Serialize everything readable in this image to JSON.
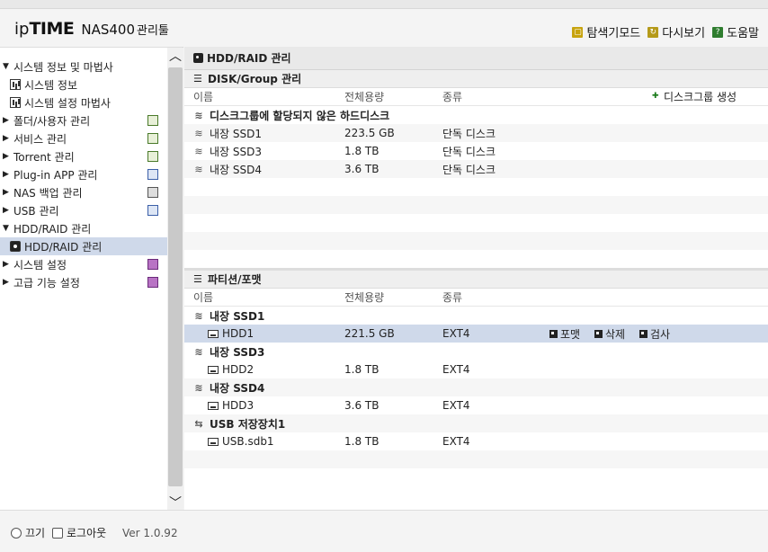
{
  "header": {
    "logo_ip": "ip",
    "logo_time": "TIME",
    "logo_model": "NAS400",
    "logo_sub": "관리툴",
    "links": [
      {
        "label": "탐색기모드",
        "icon": "explorer-icon"
      },
      {
        "label": "다시보기",
        "icon": "refresh-icon"
      },
      {
        "label": "도움말",
        "icon": "help-icon"
      }
    ]
  },
  "sidebar": {
    "items": [
      {
        "label": "시스템 정보 및 마법사",
        "expanded": true
      },
      {
        "label": "시스템 정보",
        "sub": true
      },
      {
        "label": "시스템 설정 마법사",
        "sub": true
      },
      {
        "label": "폴더/사용자 관리"
      },
      {
        "label": "서비스 관리"
      },
      {
        "label": "Torrent 관리"
      },
      {
        "label": "Plug-in APP 관리"
      },
      {
        "label": "NAS 백업 관리"
      },
      {
        "label": "USB 관리"
      },
      {
        "label": "HDD/RAID 관리",
        "expanded": true
      },
      {
        "label": "HDD/RAID 관리",
        "sub": true,
        "active": true
      },
      {
        "label": "시스템 설정"
      },
      {
        "label": "고급 기능 설정"
      }
    ]
  },
  "footer": {
    "power_label": "끄기",
    "logout_label": "로그아웃",
    "version": "Ver 1.0.92"
  },
  "main": {
    "title": "HDD/RAID 관리",
    "disk_section": {
      "title": "DISK/Group 관리",
      "col_name": "이름",
      "col_capacity": "전체용량",
      "col_type": "종류",
      "create_label": "디스크그룹 생성",
      "group_title": "디스크그룹에 할당되지 않은 하드디스크",
      "rows": [
        {
          "name": "내장 SSD1",
          "capacity": "223.5 GB",
          "type": "단독 디스크"
        },
        {
          "name": "내장 SSD3",
          "capacity": "1.8 TB",
          "type": "단독 디스크"
        },
        {
          "name": "내장 SSD4",
          "capacity": "3.6 TB",
          "type": "단독 디스크"
        }
      ]
    },
    "partition_section": {
      "title": "파티션/포맷",
      "col_name": "이름",
      "col_capacity": "전체용량",
      "col_type": "종류",
      "groups": [
        {
          "name": "내장 SSD1",
          "parts": [
            {
              "name": "HDD1",
              "capacity": "221.5 GB",
              "type": "EXT4"
            }
          ]
        },
        {
          "name": "내장 SSD3",
          "parts": [
            {
              "name": "HDD2",
              "capacity": "1.8 TB",
              "type": "EXT4"
            }
          ]
        },
        {
          "name": "내장 SSD4",
          "parts": [
            {
              "name": "HDD3",
              "capacity": "3.6 TB",
              "type": "EXT4"
            }
          ]
        },
        {
          "name": "USB 저장장치1",
          "parts": [
            {
              "name": "USB.sdb1",
              "capacity": "1.8 TB",
              "type": "EXT4"
            }
          ]
        }
      ],
      "actions": {
        "format": "포맷",
        "delete": "삭제",
        "check": "검사"
      }
    }
  }
}
